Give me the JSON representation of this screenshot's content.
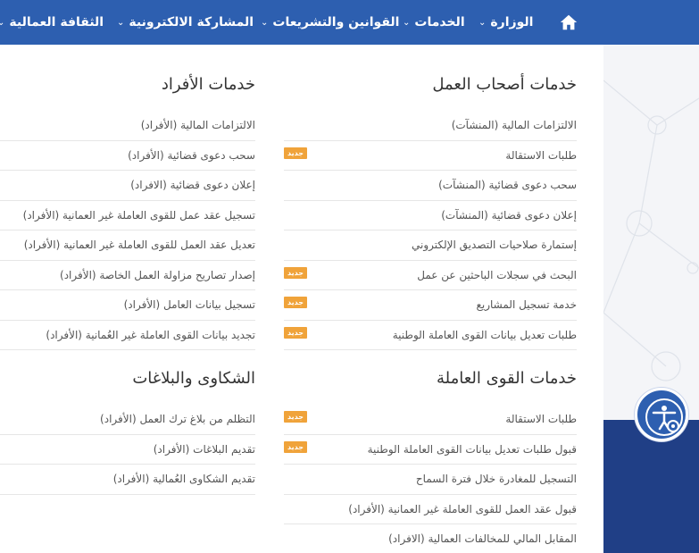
{
  "nav": {
    "items": [
      {
        "label": "الوزارة"
      },
      {
        "label": "الخدمات"
      },
      {
        "label": "القوانين والتشريعات"
      },
      {
        "label": "المشاركة الالكترونية"
      },
      {
        "label": "الثقافة العمالية"
      }
    ]
  },
  "menu": {
    "employer_services": {
      "title": "خدمات أصحاب العمل",
      "links": [
        {
          "label": "الالتزامات المالية (المنشآت)",
          "badge": ""
        },
        {
          "label": "طلبات الاستقالة",
          "badge": "جديد"
        },
        {
          "label": "سحب دعوى قضائية (المنشآت)",
          "badge": ""
        },
        {
          "label": "إعلان دعوى قضائية (المنشآت)",
          "badge": ""
        },
        {
          "label": "إستمارة صلاحيات التصديق الإلكتروني",
          "badge": ""
        },
        {
          "label": "البحث في سجلات الباحثين عن عمل",
          "badge": "جديد"
        },
        {
          "label": "خدمة تسجيل المشاريع",
          "badge": "جديد"
        },
        {
          "label": "طلبات تعديل بيانات القوى العاملة الوطنية",
          "badge": "جديد"
        }
      ]
    },
    "individual_services": {
      "title": "خدمات الأفراد",
      "links": [
        {
          "label": "الالتزامات المالية (الأفراد)"
        },
        {
          "label": "سحب دعوى قضائية (الأفراد)"
        },
        {
          "label": "إعلان دعوى قضائية (الافراد)"
        },
        {
          "label": "تسجيل عقد عمل للقوى العاملة غير العمانية (الأفراد)"
        },
        {
          "label": "تعديل عقد العمل للقوى العاملة غير العمانية (الأفراد)"
        },
        {
          "label": "إصدار تصاريح مزاولة العمل الخاصة (الأفراد)"
        },
        {
          "label": "تسجيل بيانات العامل (الأفراد)"
        },
        {
          "label": "تجديد بيانات القوى العاملة غير العُمانية (الأفراد)"
        }
      ]
    },
    "workforce_services": {
      "title": "خدمات القوى العاملة",
      "links": [
        {
          "label": "طلبات الاستقالة",
          "badge": "جديد"
        },
        {
          "label": "قبول طلبات تعديل بيانات القوى العاملة الوطنية",
          "badge": "جديد"
        },
        {
          "label": "التسجيل للمغادرة خلال فترة السماح",
          "badge": ""
        },
        {
          "label": "قبول عقد العمل للقوى العاملة غير العمانية (الأفراد)",
          "badge": ""
        },
        {
          "label": "المقابل المالي للمخالفات العمالية (الافراد)",
          "badge": ""
        }
      ]
    },
    "complaints": {
      "title": "الشكاوى والبلاغات",
      "links": [
        {
          "label": "التظلم من بلاغ ترك العمل (الأفراد)"
        },
        {
          "label": "تقديم البلاغات (الأفراد)"
        },
        {
          "label": "تقديم الشكاوى العُمالية (الأفراد)"
        }
      ]
    }
  },
  "colors": {
    "navbar": "#2d5fb0",
    "badge": "#f0a33a",
    "footer_band": "#203f86"
  },
  "icons": {
    "home": "home-icon",
    "chevron": "chevron-down-icon",
    "accessibility": "accessibility-icon"
  }
}
